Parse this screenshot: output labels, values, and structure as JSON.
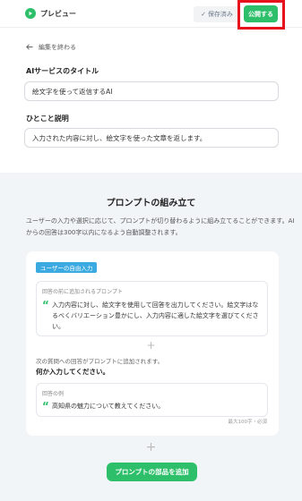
{
  "header": {
    "preview_label": "プレビュー",
    "saved_label": "保存済み",
    "publish_label": "公開する",
    "accent": "#2ebf6a",
    "highlight_color": "#e8121c"
  },
  "form": {
    "back_label": "編集を終わる",
    "title_label": "AIサービスのタイトル",
    "title_value": "絵文字を使って返信するAI",
    "desc_label": "ひとこと説明",
    "desc_value": "入力された内容に対し、絵文字を使った文章を返します。"
  },
  "prompt_section": {
    "title": "プロンプトの組み立て",
    "description": "ユーザーの入力や選択に応じて、プロンプトが切り替わるように組み立てることができます。AIからの回答は300字以内になるよう自動調整されます。",
    "tag": "ユーザーの自由入力",
    "prefix_label": "回答の前に追加されるプロンプト",
    "prefix_text": "入力内容に対し、絵文字を使用して回答を出力してください。絵文字はなるべくバリエーション豊かにし、入力内容に適した絵文字を選びてください。",
    "next_info": "次の質問への回答がプロンプトに追加されます。",
    "question": "何か入力してください。",
    "example_label": "回答の例",
    "example_text": "高知県の魅力について教えてください。",
    "limit_note": "最大100字・必須",
    "add_button": "プロンプトの部品を追加"
  }
}
